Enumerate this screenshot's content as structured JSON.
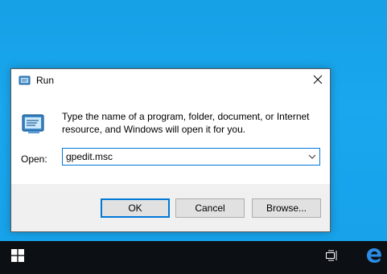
{
  "dialog": {
    "title": "Run",
    "description": "Type the name of a program, folder, document, or Internet resource, and Windows will open it for you.",
    "open_label": "Open:",
    "open_value": "gpedit.msc",
    "buttons": {
      "ok": "OK",
      "cancel": "Cancel",
      "browse": "Browse..."
    },
    "icons": {
      "title": "run-icon",
      "body": "run-icon",
      "close": "close-icon",
      "dropdown": "chevron-down-icon"
    }
  },
  "taskbar": {
    "icons": [
      "windows-start-icon",
      "task-view-icon",
      "edge-icon"
    ]
  },
  "colors": {
    "desktop": "#19a2e8",
    "taskbar": "#0c1015",
    "accent": "#0078d7",
    "edge": "#2b8de6"
  }
}
